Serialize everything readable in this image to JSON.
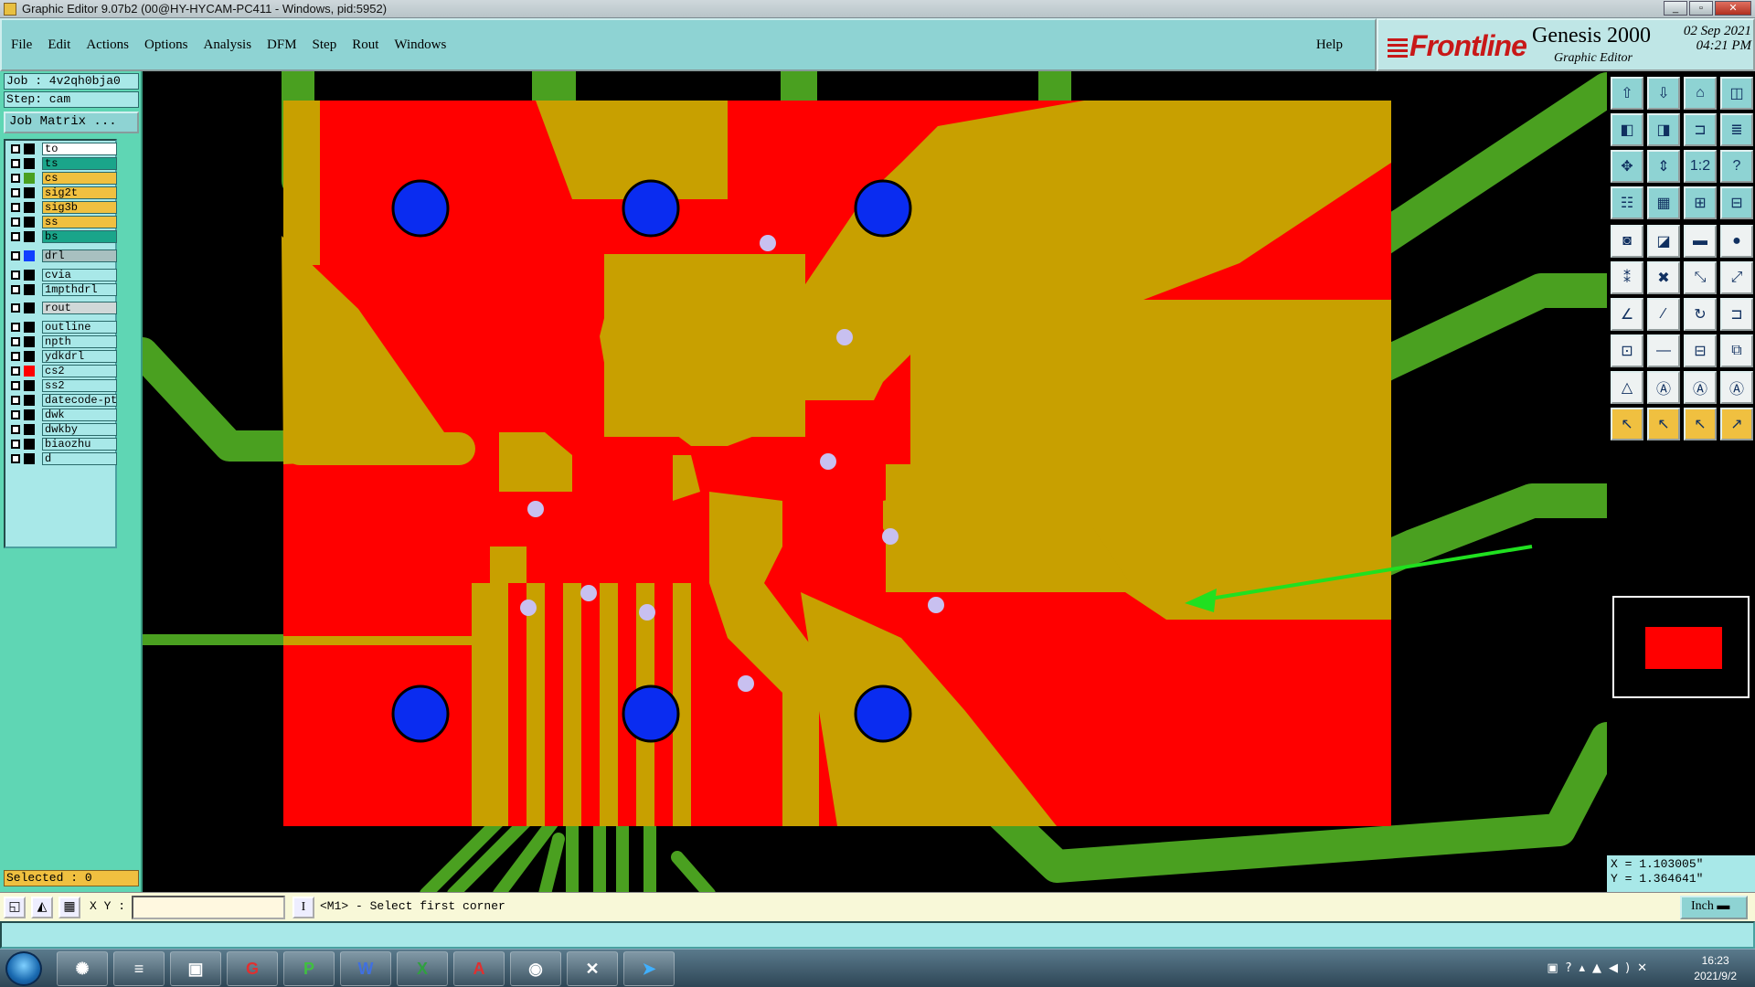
{
  "window": {
    "title": "Graphic Editor 9.07b2 (00@HY-HYCAM-PC411 - Windows, pid:5952)",
    "min": "_",
    "max": "▫",
    "close": "✕"
  },
  "menu": [
    "File",
    "Edit",
    "Actions",
    "Options",
    "Analysis",
    "DFM",
    "Step",
    "Rout",
    "Windows"
  ],
  "help_label": "Help",
  "brand": {
    "logo": "Frontline",
    "product": "Genesis 2000",
    "subtitle": "Graphic Editor",
    "date": "02 Sep 2021",
    "time": "04:21 PM"
  },
  "job": {
    "job_line": "Job : 4v2qh0bja0",
    "step_line": "Step: cam",
    "matrix_button": "Job Matrix ..."
  },
  "layers": [
    {
      "name": "to",
      "color": "#ffffff",
      "swatch": "#000000"
    },
    {
      "name": "ts",
      "color": "#1aa58a",
      "swatch": "#000000"
    },
    {
      "name": "cs",
      "color": "#f0c040",
      "swatch": "#4aa020"
    },
    {
      "name": "sig2t",
      "color": "#f0c040",
      "swatch": "#000000"
    },
    {
      "name": "sig3b",
      "color": "#f0c040",
      "swatch": "#000000"
    },
    {
      "name": "ss",
      "color": "#f0c040",
      "swatch": "#000000"
    },
    {
      "name": "bs",
      "color": "#1aa58a",
      "swatch": "#000000"
    },
    {
      "name": "drl",
      "color": "#a8c0c0",
      "swatch": "#1040ff"
    },
    {
      "name": "cvia",
      "color": "#a8e8e8",
      "swatch": "#000000"
    },
    {
      "name": "1mpthdrl",
      "color": "#a8e8e8",
      "swatch": "#000000"
    },
    {
      "name": "rout",
      "color": "#d0d8d8",
      "swatch": "#000000"
    },
    {
      "name": "outline",
      "color": "#a8e8e8",
      "swatch": "#000000"
    },
    {
      "name": "npth",
      "color": "#a8e8e8",
      "swatch": "#000000"
    },
    {
      "name": "ydkdrl",
      "color": "#a8e8e8",
      "swatch": "#000000"
    },
    {
      "name": "cs2",
      "color": "#a8e8e8",
      "swatch": "#ff0000"
    },
    {
      "name": "ss2",
      "color": "#a8e8e8",
      "swatch": "#000000"
    },
    {
      "name": "datecode-pto",
      "color": "#a8e8e8",
      "swatch": "#000000"
    },
    {
      "name": "dwk",
      "color": "#a8e8e8",
      "swatch": "#000000"
    },
    {
      "name": "dwkby",
      "color": "#a8e8e8",
      "swatch": "#000000"
    },
    {
      "name": "biaozhu",
      "color": "#a8e8e8",
      "swatch": "#000000"
    },
    {
      "name": "d",
      "color": "#a8e8e8",
      "swatch": "#000000"
    }
  ],
  "selected_label": "Selected : 0",
  "coords": {
    "x": "X =  1.103005\"",
    "y": "Y =  1.364641\""
  },
  "status": {
    "xy_label": "X Y :",
    "prompt": "<M1> - Select first corner",
    "unit": "Inch"
  },
  "clock": {
    "time": "16:23",
    "date": "2021/9/2"
  },
  "colors": {
    "board": "#ff0000",
    "copper": "#4aa020",
    "overlap": "#c8a000",
    "drill": "#0a2cf0",
    "via": "#c8c0f0",
    "arrow": "#20e020"
  }
}
